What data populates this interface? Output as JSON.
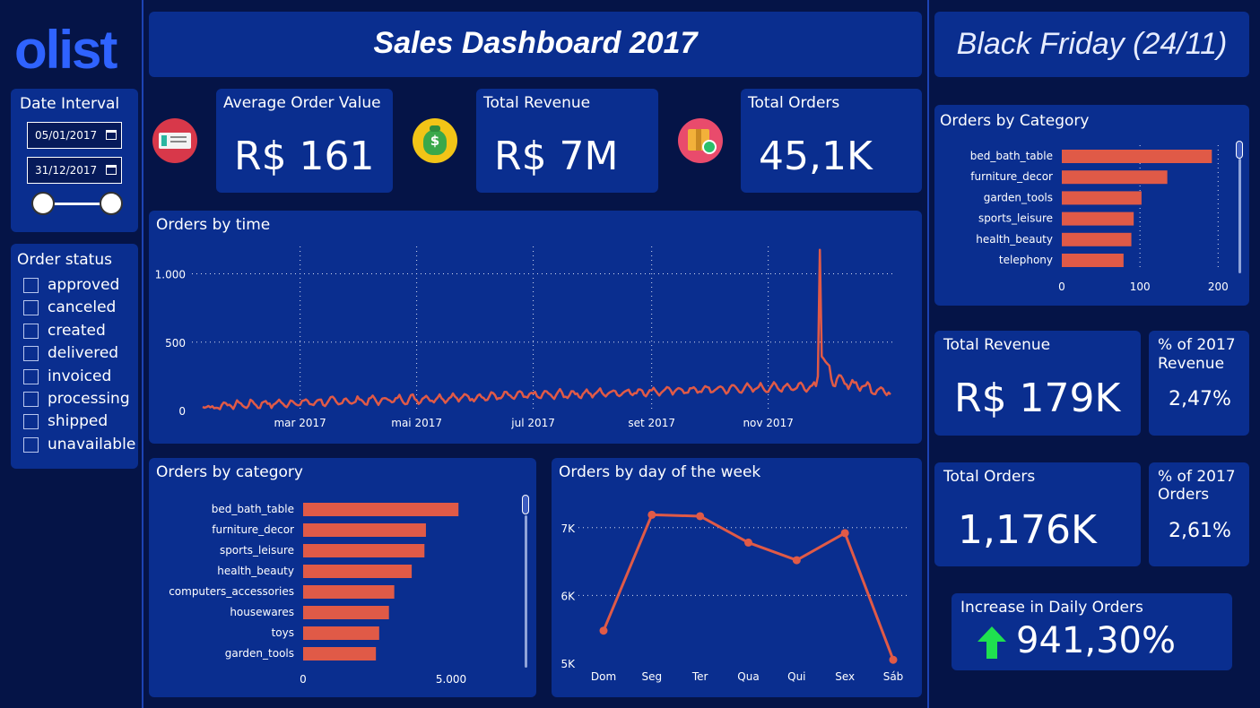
{
  "logo": {
    "text": "olist"
  },
  "header": {
    "title": "Sales Dashboard 2017"
  },
  "black_friday": {
    "title": "Black Friday (24/11)"
  },
  "filters": {
    "date_interval_label": "Date Interval",
    "start_date": "05/01/2017",
    "end_date": "31/12/2017",
    "order_status_label": "Order status",
    "statuses": [
      "approved",
      "canceled",
      "created",
      "delivered",
      "invoiced",
      "processing",
      "shipped",
      "unavailable"
    ]
  },
  "kpis": {
    "avg_order_value": {
      "label": "Average Order Value",
      "value": "R$ 161"
    },
    "total_revenue": {
      "label": "Total Revenue",
      "value": "R$ 7M"
    },
    "total_orders": {
      "label": "Total Orders",
      "value": "45,1K"
    }
  },
  "bf_kpis": {
    "total_revenue": {
      "label": "Total Revenue",
      "value": "R$ 179K"
    },
    "pct_revenue": {
      "label_line1": "% of 2017",
      "label_line2": "Revenue",
      "value": "2,47%"
    },
    "total_orders": {
      "label": "Total Orders",
      "value": "1,176K"
    },
    "pct_orders": {
      "label_line1": "% of 2017",
      "label_line2": "Orders",
      "value": "2,61%"
    },
    "increase_daily": {
      "label": "Increase in Daily Orders",
      "value": "941,30%"
    }
  },
  "icons": {
    "avg_order": "receipt-icon",
    "revenue": "money-bag-icon",
    "orders": "package-check-icon",
    "increase": "arrow-up-icon"
  },
  "colors": {
    "background": "#051447",
    "panel": "#0a2e8f",
    "accent_bar": "#e05a47",
    "logo": "#2f63ff",
    "arrow": "#1fe04f"
  },
  "chart_data": [
    {
      "id": "orders_by_time",
      "type": "line",
      "title": "Orders by time",
      "ylim": [
        0,
        1200
      ],
      "y_ticks": [
        0,
        500,
        1000
      ],
      "y_tick_labels": [
        "0",
        "500",
        "1.000"
      ],
      "x_tick_labels": [
        "mar 2017",
        "mai 2017",
        "jul 2017",
        "set 2017",
        "nov 2017"
      ],
      "x_tick_days": [
        55,
        116,
        177,
        239,
        300
      ],
      "x_range_days": [
        4,
        364
      ],
      "peak": {
        "day": 327,
        "value": 1176
      },
      "grid": true
    },
    {
      "id": "orders_by_category",
      "type": "bar",
      "orientation": "horizontal",
      "title": "Orders by category",
      "categories": [
        "bed_bath_table",
        "furniture_decor",
        "sports_leisure",
        "health_beauty",
        "computers_accessories",
        "housewares",
        "toys",
        "garden_tools"
      ],
      "values": [
        5250,
        4150,
        4100,
        3670,
        3080,
        2900,
        2570,
        2460
      ],
      "xlim": [
        0,
        6000
      ],
      "x_ticks": [
        0,
        5000
      ],
      "x_tick_labels": [
        "0",
        "5.000"
      ]
    },
    {
      "id": "orders_by_day_of_week",
      "type": "line",
      "title": "Orders by day of the week",
      "categories": [
        "Dom",
        "Seg",
        "Ter",
        "Qua",
        "Qui",
        "Sex",
        "Sáb"
      ],
      "values": [
        5480,
        7190,
        7170,
        6780,
        6520,
        6920,
        5050
      ],
      "ylim": [
        5000,
        7500
      ],
      "y_ticks": [
        5000,
        6000,
        7000
      ],
      "y_tick_labels": [
        "5K",
        "6K",
        "7K"
      ],
      "grid": true
    },
    {
      "id": "bf_orders_by_category",
      "type": "bar",
      "orientation": "horizontal",
      "title": "Orders by Category",
      "categories": [
        "bed_bath_table",
        "furniture_decor",
        "garden_tools",
        "sports_leisure",
        "health_beauty",
        "telephony"
      ],
      "values": [
        192,
        135,
        102,
        92,
        89,
        79
      ],
      "xlim": [
        0,
        210
      ],
      "x_ticks": [
        0,
        100,
        200
      ],
      "x_tick_labels": [
        "0",
        "100",
        "200"
      ],
      "grid": true
    }
  ]
}
